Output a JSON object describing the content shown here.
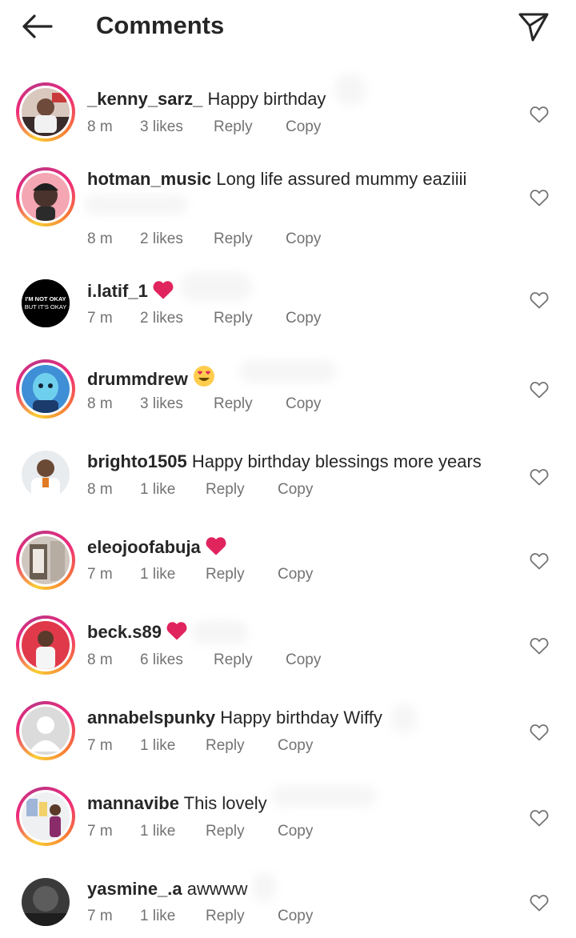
{
  "header": {
    "title": "Comments",
    "back_icon": "arrow-left-icon",
    "share_icon": "send-icon"
  },
  "comments": [
    {
      "username": "_kenny_sarz_",
      "text": "Happy birthday",
      "emoji": "",
      "time": "8 m",
      "likes": "3 likes",
      "reply": "Reply",
      "copy": "Copy",
      "ring": true
    },
    {
      "username": "hotman_music",
      "text": "Long life assured mummy eaziiii",
      "emoji": "",
      "time": "8 m",
      "likes": "2 likes",
      "reply": "Reply",
      "copy": "Copy",
      "ring": true
    },
    {
      "username": "i.latif_1",
      "text": "",
      "emoji": "red-heart",
      "time": "7 m",
      "likes": "2 likes",
      "reply": "Reply",
      "copy": "Copy",
      "ring": false,
      "avatar_text": [
        "I'M NOT OKAY",
        "BUT IT'S OKAY"
      ]
    },
    {
      "username": "drummdrew",
      "text": "",
      "emoji": "heart-eyes",
      "time": "8 m",
      "likes": "3 likes",
      "reply": "Reply",
      "copy": "Copy",
      "ring": true
    },
    {
      "username": "brighto1505",
      "text": "Happy birthday blessings more years",
      "emoji": "",
      "time": "8 m",
      "likes": "1 like",
      "reply": "Reply",
      "copy": "Copy",
      "ring": false
    },
    {
      "username": "eleojoofabuja",
      "text": "",
      "emoji": "red-heart",
      "time": "7 m",
      "likes": "1 like",
      "reply": "Reply",
      "copy": "Copy",
      "ring": true
    },
    {
      "username": "beck.s89",
      "text": "",
      "emoji": "red-heart",
      "time": "8 m",
      "likes": "6 likes",
      "reply": "Reply",
      "copy": "Copy",
      "ring": true
    },
    {
      "username": "annabelspunky",
      "text": "Happy birthday Wiffy",
      "emoji": "",
      "time": "7 m",
      "likes": "1 like",
      "reply": "Reply",
      "copy": "Copy",
      "ring": true
    },
    {
      "username": "mannavibe",
      "text": "This lovely",
      "emoji": "",
      "time": "7 m",
      "likes": "1 like",
      "reply": "Reply",
      "copy": "Copy",
      "ring": true
    },
    {
      "username": "yasmine_.a",
      "text": "awwww",
      "emoji": "",
      "time": "7 m",
      "likes": "1 like",
      "reply": "Reply",
      "copy": "Copy",
      "ring": false
    }
  ],
  "colors": {
    "text": "#262626",
    "meta": "#737373",
    "heart": "#e0245e",
    "ring_start": "#f9ce34",
    "ring_mid": "#ee2a7b",
    "ring_end": "#c13584"
  }
}
